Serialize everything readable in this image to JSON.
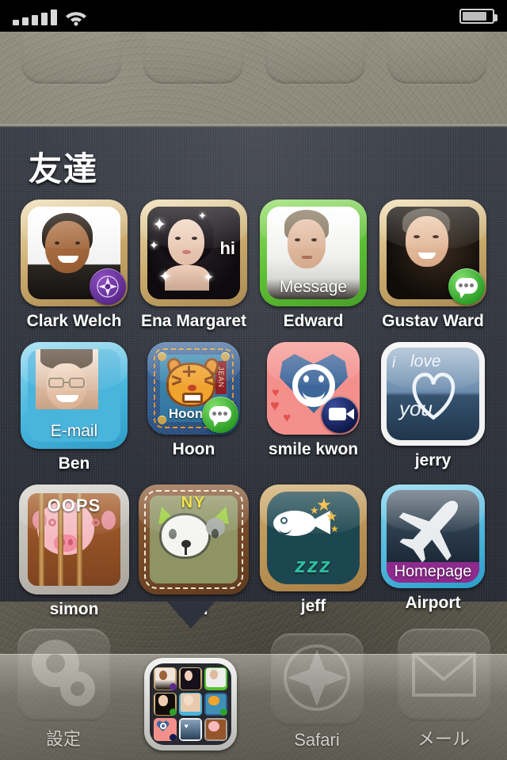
{
  "status_bar": {
    "signal_icon": "signal-bars-icon",
    "signal_bars": 5,
    "wifi_icon": "wifi-icon",
    "battery_icon": "battery-icon",
    "battery_level_percent": 84
  },
  "folder": {
    "title": "友達",
    "open": true,
    "page": 1,
    "contacts": [
      {
        "name": "Clark Welch",
        "caption": "",
        "badge": "safari-badge-icon",
        "frame": "gold",
        "art": "photo-man-smiling"
      },
      {
        "name": "Ena Margaret",
        "caption": "hi",
        "badge": "",
        "frame": "gold",
        "art": "photo-woman-sparkles"
      },
      {
        "name": "Edward",
        "caption": "Message",
        "badge": "",
        "frame": "green",
        "art": "photo-man-blond"
      },
      {
        "name": "Gustav Ward",
        "caption": "",
        "badge": "message-badge-icon",
        "frame": "gold",
        "art": "photo-man-dark"
      },
      {
        "name": "Ben",
        "caption": "E-mail",
        "badge": "",
        "frame": "blue",
        "art": "photo-man-glasses"
      },
      {
        "name": "Hoon",
        "caption": "Hoon^^",
        "badge": "message-badge-icon",
        "frame": "denim",
        "art": "tiger-face",
        "tag": "JEAN"
      },
      {
        "name": "smile kwon",
        "caption": "",
        "badge": "facetime-badge-icon",
        "frame": "none",
        "art": "heart-smiley"
      },
      {
        "name": "jerry",
        "caption": "i love you",
        "badge": "",
        "frame": "white",
        "art": "handwritten-heart"
      },
      {
        "name": "simon",
        "caption": "OOPS",
        "badge": "",
        "frame": "metal",
        "art": "pig-behind-bars"
      },
      {
        "name": "neil",
        "caption": "NY",
        "badge": "",
        "frame": "stitch",
        "art": "cat-face"
      },
      {
        "name": "jeff",
        "caption": "zzz",
        "badge": "",
        "frame": "torn",
        "art": "sleeping-fish"
      },
      {
        "name": "Airport",
        "caption": "Homepage",
        "badge": "",
        "frame": "none",
        "art": "airplane"
      }
    ]
  },
  "dock": {
    "items": [
      {
        "label": "設定",
        "icon": "gear-icon",
        "type": "app"
      },
      {
        "label": "",
        "icon": "folder-icon",
        "type": "folder",
        "selected": true
      },
      {
        "label": "Safari",
        "icon": "compass-icon",
        "type": "app"
      },
      {
        "label": "メール",
        "icon": "envelope-icon",
        "type": "app"
      }
    ]
  },
  "colors": {
    "folder_bg": "#2e323c",
    "message_green": "#2fa028",
    "safari_purple": "#5b2a8d",
    "facetime_navy": "#101a4d",
    "homepage_purple": "#8e2a8e"
  }
}
